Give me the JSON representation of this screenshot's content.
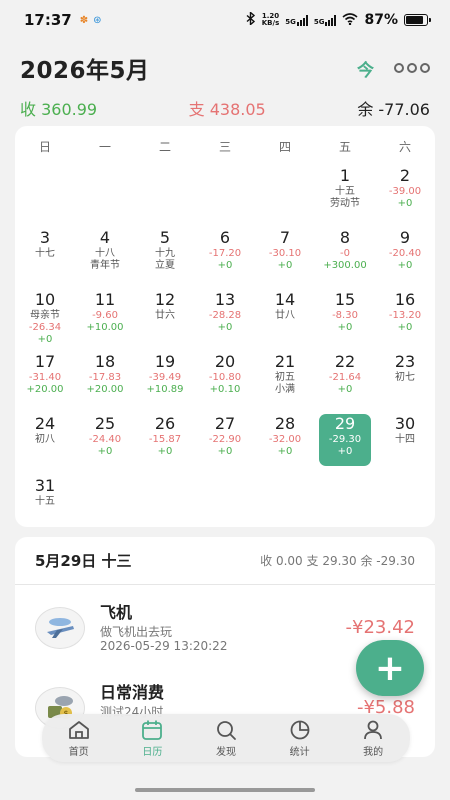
{
  "status_bar": {
    "time": "17:37",
    "speed_value": "1.20",
    "speed_unit": "KB/s",
    "sim1": "5G",
    "sim2": "5G",
    "battery_pct": "87%",
    "battery_level": 0.87
  },
  "header": {
    "month_title": "2026年5月",
    "today_label": "今"
  },
  "summary": {
    "income": "收 360.99",
    "expense": "支 438.05",
    "balance": "余 -77.06"
  },
  "calendar": {
    "weekdays": [
      "日",
      "一",
      "二",
      "三",
      "四",
      "五",
      "六"
    ],
    "days": [
      {
        "d": "",
        "l": "",
        "e": "",
        "i": ""
      },
      {
        "d": "",
        "l": "",
        "e": "",
        "i": ""
      },
      {
        "d": "",
        "l": "",
        "e": "",
        "i": ""
      },
      {
        "d": "",
        "l": "",
        "e": "",
        "i": ""
      },
      {
        "d": "",
        "l": "",
        "e": "",
        "i": ""
      },
      {
        "d": "1",
        "l": "十五",
        "f": "劳动节",
        "e": "",
        "i": ""
      },
      {
        "d": "2",
        "l": "",
        "e": "-39.00",
        "i": "+0"
      },
      {
        "d": "3",
        "l": "十七",
        "e": "",
        "i": ""
      },
      {
        "d": "4",
        "l": "十八",
        "f": "青年节",
        "e": "",
        "i": ""
      },
      {
        "d": "5",
        "l": "十九",
        "f": "立夏",
        "e": "",
        "i": ""
      },
      {
        "d": "6",
        "l": "",
        "e": "-17.20",
        "i": "+0"
      },
      {
        "d": "7",
        "l": "",
        "e": "-30.10",
        "i": "+0"
      },
      {
        "d": "8",
        "l": "",
        "e": "-0",
        "i": "+300.00"
      },
      {
        "d": "9",
        "l": "",
        "e": "-20.40",
        "i": "+0"
      },
      {
        "d": "10",
        "l": "母亲节",
        "e": "-26.34",
        "i": "+0"
      },
      {
        "d": "11",
        "l": "",
        "e": "-9.60",
        "i": "+10.00"
      },
      {
        "d": "12",
        "l": "廿六",
        "e": "",
        "i": ""
      },
      {
        "d": "13",
        "l": "",
        "e": "-28.28",
        "i": "+0"
      },
      {
        "d": "14",
        "l": "廿八",
        "e": "",
        "i": ""
      },
      {
        "d": "15",
        "l": "",
        "e": "-8.30",
        "i": "+0"
      },
      {
        "d": "16",
        "l": "",
        "e": "-13.20",
        "i": "+0"
      },
      {
        "d": "17",
        "l": "",
        "e": "-31.40",
        "i": "+20.00"
      },
      {
        "d": "18",
        "l": "",
        "e": "-17.83",
        "i": "+20.00"
      },
      {
        "d": "19",
        "l": "",
        "e": "-39.49",
        "i": "+10.89"
      },
      {
        "d": "20",
        "l": "",
        "e": "-10.80",
        "i": "+0.10"
      },
      {
        "d": "21",
        "l": "初五",
        "f": "小满",
        "e": "",
        "i": ""
      },
      {
        "d": "22",
        "l": "",
        "e": "-21.64",
        "i": "+0"
      },
      {
        "d": "23",
        "l": "初七",
        "e": "",
        "i": ""
      },
      {
        "d": "24",
        "l": "初八",
        "e": "",
        "i": ""
      },
      {
        "d": "25",
        "l": "",
        "e": "-24.40",
        "i": "+0"
      },
      {
        "d": "26",
        "l": "",
        "e": "-15.87",
        "i": "+0"
      },
      {
        "d": "27",
        "l": "",
        "e": "-22.90",
        "i": "+0"
      },
      {
        "d": "28",
        "l": "",
        "e": "-32.00",
        "i": "+0"
      },
      {
        "d": "29",
        "l": "",
        "e": "-29.30",
        "i": "+0",
        "selected": true
      },
      {
        "d": "30",
        "l": "十四",
        "e": "",
        "i": ""
      },
      {
        "d": "31",
        "l": "十五",
        "e": "",
        "i": ""
      }
    ]
  },
  "detail": {
    "date": "5月29日 十三",
    "summary": "收 0.00 支 29.30 余 -29.30",
    "entries": [
      {
        "title": "飞机",
        "note": "做飞机出去玩",
        "time": "2026-05-29 13:20:22",
        "amount": "-¥23.42",
        "icon": "airplane-icon"
      },
      {
        "title": "日常消费",
        "note": "测试24小时",
        "time": "",
        "amount": "-¥5.88",
        "icon": "shopping-icon"
      }
    ]
  },
  "fab": {
    "label": "+"
  },
  "nav": {
    "items": [
      {
        "label": "首页",
        "icon": "home-icon"
      },
      {
        "label": "日历",
        "icon": "calendar-icon",
        "active": true
      },
      {
        "label": "发现",
        "icon": "search-icon"
      },
      {
        "label": "统计",
        "icon": "pie-chart-icon"
      },
      {
        "label": "我的",
        "icon": "user-icon"
      }
    ]
  },
  "colors": {
    "accent": "#4caf8c",
    "income": "#4caf50",
    "expense": "#e57373"
  }
}
